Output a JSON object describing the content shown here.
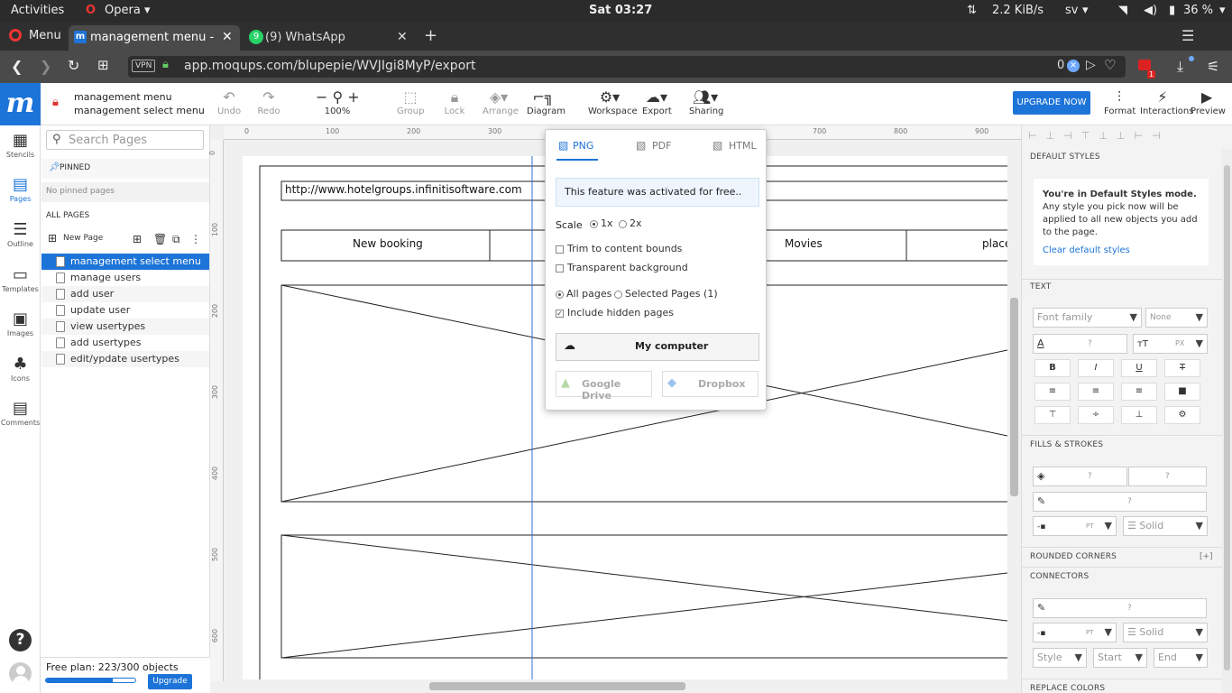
{
  "os_bar": {
    "activities": "Activities",
    "app": "Opera",
    "clock": "Sat 03:27",
    "net_speed": "2.2 KiB/s",
    "lang": "sv",
    "battery": "36 %"
  },
  "browser": {
    "menu_label": "Menu",
    "tabs": [
      {
        "label": "management menu - man"
      },
      {
        "label": "(9) WhatsApp"
      }
    ],
    "whatsapp_badge": "9",
    "vpn": "VPN",
    "url": "app.moqups.com/blupepie/WVJIgi8MyP/export",
    "ad_count": "0",
    "download_badge": "1"
  },
  "project": {
    "title": "management menu",
    "page": "management select menu"
  },
  "toolbar": {
    "undo": "Undo",
    "redo": "Redo",
    "zoom": "100%",
    "group": "Group",
    "lock": "Lock",
    "arrange": "Arrange",
    "diagram": "Diagram",
    "workspace": "Workspace",
    "export": "Export",
    "sharing": "Sharing",
    "upgrade": "UPGRADE NOW",
    "format": "Format",
    "interactions": "Interactions",
    "preview": "Preview"
  },
  "rail": [
    "Stencils",
    "Pages",
    "Outline",
    "Templates",
    "Images",
    "Icons",
    "Comments"
  ],
  "pages_panel": {
    "search_placeholder": "Search Pages",
    "pinned": "PINNED",
    "no_pinned": "No pinned pages",
    "all_pages": "ALL PAGES",
    "new_page": "New Page",
    "pages": [
      {
        "label": "management select menu"
      },
      {
        "label": "manage users"
      },
      {
        "label": "add user"
      },
      {
        "label": "update user"
      },
      {
        "label": "view usertypes"
      },
      {
        "label": "add usertypes"
      },
      {
        "label": "edit/ypdate usertypes"
      }
    ],
    "plan": "Free plan: 223/300 objects",
    "plan_progress": 0.743,
    "upgrade": "Upgrade"
  },
  "canvas": {
    "ruler_top": [
      "0",
      "100",
      "200",
      "300",
      "700",
      "800",
      "900"
    ],
    "ruler_left": [
      "0",
      "100",
      "200",
      "300",
      "400",
      "500",
      "600"
    ],
    "url_field": "http://www.hotelgroups.infinitisoftware.com",
    "nav_items": [
      "New booking",
      "Movies",
      "place"
    ]
  },
  "export_popup": {
    "tabs": [
      "PNG",
      "PDF",
      "HTML"
    ],
    "notice": "This feature was activated for free..",
    "scale_label": "Scale",
    "scale_1x": "1x",
    "scale_2x": "2x",
    "trim": "Trim to content bounds",
    "transparent": "Transparent background",
    "all_pages": "All pages",
    "selected_pages": "Selected Pages (1)",
    "include_hidden": "Include hidden pages",
    "my_computer": "My computer",
    "google_drive": "Google Drive",
    "dropbox": "Dropbox"
  },
  "right_panel": {
    "default_styles": "DEFAULT STYLES",
    "ds_title": "You're in Default Styles mode.",
    "ds_body": "Any style you pick now will be applied to all new objects you add to the page.",
    "clear": "Clear default styles",
    "text": "TEXT",
    "font_family": "Font family",
    "font_weight": "None",
    "q": "?",
    "px": "PX",
    "fills": "FILLS & STROKES",
    "pt": "PT",
    "solid": "Solid",
    "rounded": "ROUNDED CORNERS",
    "plus": "[+]",
    "connectors": "CONNECTORS",
    "style": "Style",
    "start": "Start",
    "end": "End",
    "replace": "REPLACE COLORS"
  }
}
